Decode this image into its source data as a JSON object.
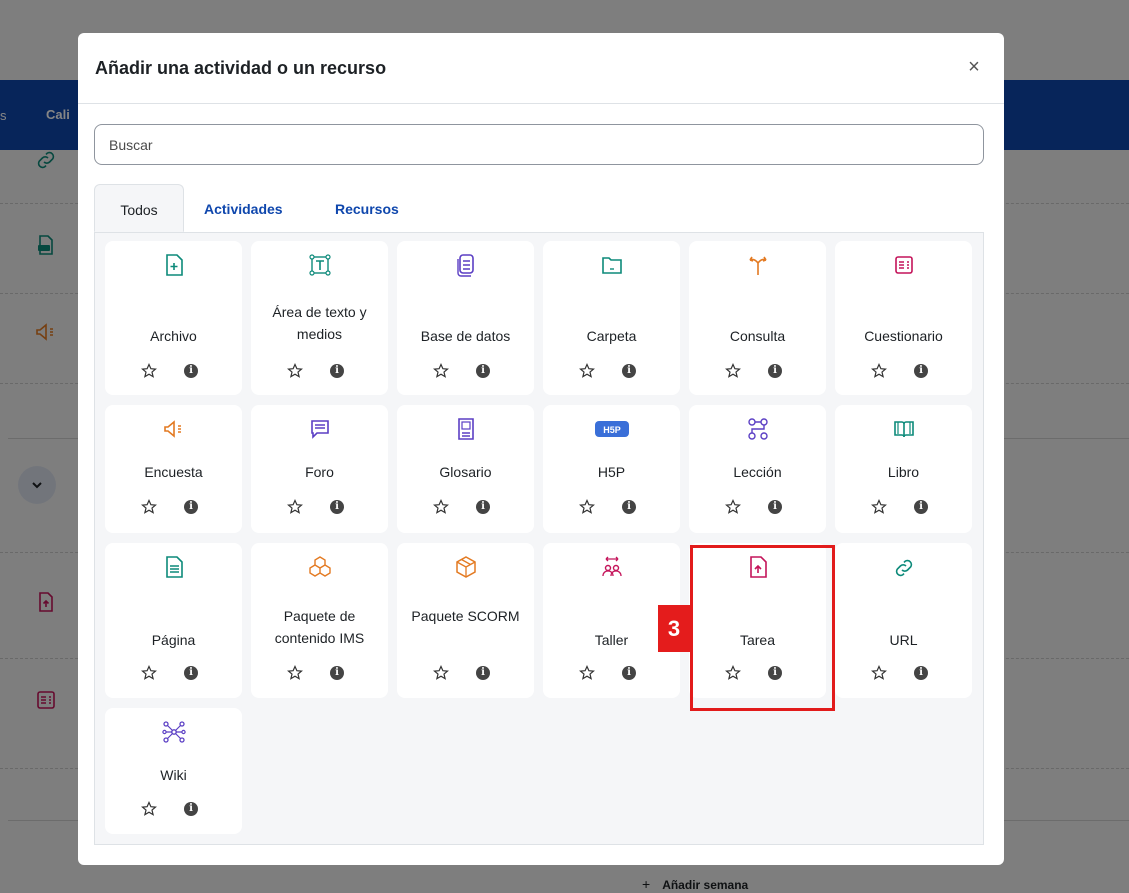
{
  "background": {
    "nav_tab_label": "Cali",
    "nav_dot": "s",
    "add_week_label": "Añadir semana",
    "add_week_plus": "+"
  },
  "modal": {
    "title": "Añadir una actividad o un recurso",
    "close_label": "×",
    "search_placeholder": "Buscar",
    "tabs": [
      {
        "label": "Todos",
        "active": true
      },
      {
        "label": "Actividades",
        "active": false
      },
      {
        "label": "Recursos",
        "active": false
      }
    ],
    "items": [
      {
        "label": "Archivo",
        "icon": "file-add-icon",
        "color": "#0d8a7a"
      },
      {
        "label": "Área de texto y medios",
        "icon": "text-area-icon",
        "color": "#0d8a7a"
      },
      {
        "label": "Base de datos",
        "icon": "database-icon",
        "color": "#5b3fc4"
      },
      {
        "label": "Carpeta",
        "icon": "folder-icon",
        "color": "#0d8a7a"
      },
      {
        "label": "Consulta",
        "icon": "choice-icon",
        "color": "#e37a22"
      },
      {
        "label": "Cuestionario",
        "icon": "quiz-icon",
        "color": "#c4145a"
      },
      {
        "label": "Encuesta",
        "icon": "megaphone-icon",
        "color": "#e37a22"
      },
      {
        "label": "Foro",
        "icon": "forum-icon",
        "color": "#5b3fc4"
      },
      {
        "label": "Glosario",
        "icon": "glossary-icon",
        "color": "#5b3fc4"
      },
      {
        "label": "H5P",
        "icon": "h5p-icon",
        "color": "#3a6fd8"
      },
      {
        "label": "Lección",
        "icon": "lesson-icon",
        "color": "#5b3fc4"
      },
      {
        "label": "Libro",
        "icon": "book-icon",
        "color": "#0d8a7a"
      },
      {
        "label": "Página",
        "icon": "page-icon",
        "color": "#0d8a7a"
      },
      {
        "label": "Paquete de contenido IMS",
        "icon": "ims-package-icon",
        "color": "#e37a22"
      },
      {
        "label": "Paquete SCORM",
        "icon": "scorm-package-icon",
        "color": "#e37a22"
      },
      {
        "label": "Taller",
        "icon": "workshop-icon",
        "color": "#c4145a"
      },
      {
        "label": "Tarea",
        "icon": "assignment-upload-icon",
        "color": "#c4145a"
      },
      {
        "label": "URL",
        "icon": "link-icon",
        "color": "#0d8a7a"
      },
      {
        "label": "Wiki",
        "icon": "wiki-icon",
        "color": "#5b3fc4"
      }
    ],
    "info_glyph": "i"
  },
  "annotation": {
    "step_number": "3"
  }
}
